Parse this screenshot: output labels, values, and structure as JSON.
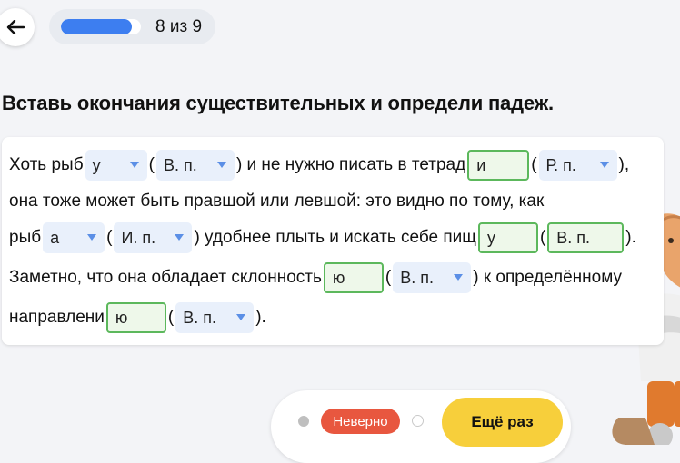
{
  "header": {
    "progress_label": "8 из 9",
    "progress_fraction": 0.889
  },
  "task": {
    "title": "Вставь окончания существительных и определи падеж."
  },
  "exercise": {
    "line1": {
      "t1": "Хоть рыб",
      "sel1": "у",
      "t2": "(",
      "sel2": "В. п.",
      "t3": ") и не нужно писать в тетрад",
      "inp1": "и",
      "t4": "(",
      "sel3": "Р. п.",
      "t5": "),"
    },
    "line2": {
      "t1": "она тоже может быть правшой или левшой: это видно по тому, как"
    },
    "line3": {
      "t1": "рыб",
      "sel1": "а",
      "t2": "(",
      "sel2": "И. п.",
      "t3": ") удобнее плыть и искать себе пищ",
      "inp1": "у",
      "t4": "(",
      "inp2": "В. п.",
      "t5": ")."
    },
    "line4": {
      "t1": "Заметно, что она обладает склонность",
      "inp1": "ю",
      "t2": "(",
      "sel1": "В. п.",
      "t3": ") к определённому"
    },
    "line5": {
      "t1": "направлени",
      "inp1": "ю",
      "t2": "(",
      "sel1": "В. п.",
      "t3": ")."
    }
  },
  "footer": {
    "status_badge": "Неверно",
    "retry_label": "Ещё раз"
  },
  "colors": {
    "progress": "#3d7ef0",
    "badge": "#e8573f",
    "retry": "#f7cf3b",
    "input_border": "#5cb85c",
    "select_bg": "#e9f0fb"
  }
}
